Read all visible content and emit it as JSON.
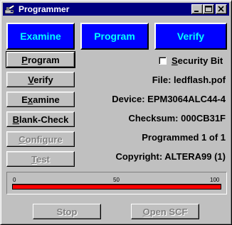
{
  "window": {
    "title": "Programmer"
  },
  "big_buttons": {
    "examine": "Examine",
    "program": "Program",
    "verify": "Verify"
  },
  "buttons": {
    "program": {
      "pre": "",
      "mn": "P",
      "post": "rogram"
    },
    "verify": {
      "pre": "",
      "mn": "V",
      "post": "erify"
    },
    "examine": {
      "pre": "E",
      "mn": "x",
      "post": "amine"
    },
    "blank_check": {
      "pre": "",
      "mn": "B",
      "post": "lank-Check"
    },
    "configure": {
      "pre": "",
      "mn": "C",
      "post": "onfigure"
    },
    "test": {
      "pre": "",
      "mn": "T",
      "post": "est"
    },
    "stop": "Stop",
    "open_scf": {
      "pre": "",
      "mn": "O",
      "post": "pen SCF"
    }
  },
  "security_bit": {
    "pre": "",
    "mn": "S",
    "post": "ecurity Bit",
    "checked": false
  },
  "info": {
    "file": "File: ledflash.pof",
    "device": "Device: EPM3064ALC44-4",
    "checksum": "Checksum: 000CB31F",
    "programmed": "Programmed 1 of 1",
    "copyright": "Copyright: ALTERA99 (1)"
  },
  "progress": {
    "value": 100,
    "label_0": "0",
    "label_50": "50",
    "label_100": "100"
  },
  "colors": {
    "titlebar": "#000080",
    "big_button_bg": "#0000ff",
    "big_button_text": "#00ffff",
    "progress_fill": "#ff0000"
  }
}
